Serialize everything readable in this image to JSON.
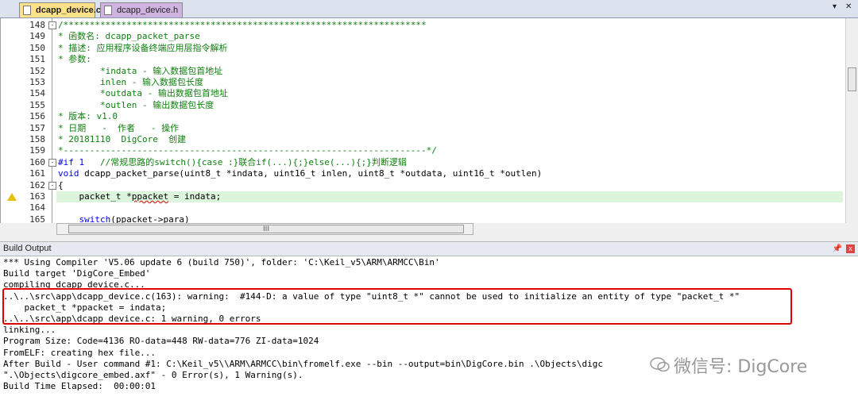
{
  "tabs": [
    {
      "label": "dcapp_device.c",
      "active": true
    },
    {
      "label": "dcapp_device.h",
      "active": false
    }
  ],
  "tab_controls": {
    "dropdown": "▾",
    "close": "✕"
  },
  "editor": {
    "lines": [
      {
        "n": "148",
        "fold": "-",
        "text": "/*********************************************************************",
        "cls": "c-cm"
      },
      {
        "n": "149",
        "text": "* 函数名: dcapp_packet_parse",
        "cls": "c-cm"
      },
      {
        "n": "150",
        "text": "* 描述: 应用程序设备终端应用层指令解析",
        "cls": "c-cm"
      },
      {
        "n": "151",
        "text": "* 参数:",
        "cls": "c-cm"
      },
      {
        "n": "152",
        "text": "        *indata - 输入数据包首地址",
        "cls": "c-cm"
      },
      {
        "n": "153",
        "text": "        inlen - 输入数据包长度",
        "cls": "c-cm"
      },
      {
        "n": "154",
        "text": "        *outdata - 输出数据包首地址",
        "cls": "c-cm"
      },
      {
        "n": "155",
        "text": "        *outlen - 输出数据包长度",
        "cls": "c-cm"
      },
      {
        "n": "156",
        "text": "* 版本: v1.0",
        "cls": "c-cm"
      },
      {
        "n": "157",
        "text": "* 日期   -  作者   - 操作",
        "cls": "c-cm"
      },
      {
        "n": "158",
        "text": "* 20181110  DigCore  创建",
        "cls": "c-cm"
      },
      {
        "n": "159",
        "text": "*---------------------------------------------------------------------*/",
        "cls": "c-cm"
      },
      {
        "n": "160",
        "fold": "-",
        "pre": "#if 1",
        "text": "   //常规思路的switch(){case :}联合if(...){;}else(...){;}判断逻辑",
        "cls": "c-cm"
      },
      {
        "n": "161",
        "kw": "void",
        "text": " dcapp_packet_parse(uint8_t *indata, uint16_t inlen, uint8_t *outdata, uint16_t *outlen)"
      },
      {
        "n": "162",
        "fold": "-",
        "text": "{"
      },
      {
        "n": "163",
        "warn": true,
        "hl": true,
        "text": "    packet_t *",
        "squig": "ppacket",
        "post": " = indata;"
      },
      {
        "n": "164",
        "text": ""
      },
      {
        "n": "165",
        "kw2": "    switch",
        "text": "(ppacket->para)"
      }
    ]
  },
  "hscroll_grip": "III",
  "build_output": {
    "title": "Build Output",
    "pin": "📌",
    "close": "x",
    "lines": [
      "*** Using Compiler 'V5.06 update 6 (build 750)', folder: 'C:\\Keil_v5\\ARM\\ARMCC\\Bin'",
      "Build target 'DigCore_Embed'",
      "compiling dcapp_device.c...",
      "..\\..\\src\\app\\dcapp_device.c(163): warning:  #144-D: a value of type \"uint8_t *\" cannot be used to initialize an entity of type \"packet_t *\"",
      "    packet_t *ppacket = indata;",
      "..\\..\\src\\app\\dcapp_device.c: 1 warning, 0 errors",
      "linking...",
      "Program Size: Code=4136 RO-data=448 RW-data=776 ZI-data=1024",
      "FromELF: creating hex file...",
      "After Build - User command #1: C:\\Keil_v5\\\\ARM\\ARMCC\\bin\\fromelf.exe --bin --output=bin\\DigCore.bin .\\Objects\\digc",
      "\".\\Objects\\digcore_embed.axf\" - 0 Error(s), 1 Warning(s).",
      "Build Time Elapsed:  00:00:01"
    ]
  },
  "watermark": "微信号: DigCore"
}
